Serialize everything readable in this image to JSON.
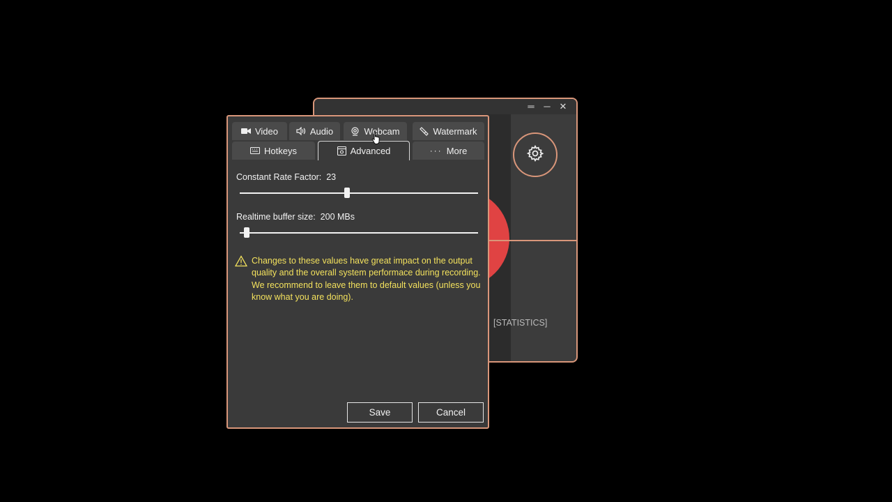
{
  "main_window": {
    "title_buttons": {
      "menu": "═",
      "minimize": "─",
      "close": "✕"
    },
    "statistics_label": "[STATISTICS]",
    "colors": {
      "accent": "#d9967a",
      "record": "#e04343"
    },
    "icons": {
      "settings": "gear-icon"
    }
  },
  "settings": {
    "tabs_row1": [
      {
        "label": "Video",
        "icon": "video-camera-icon"
      },
      {
        "label": "Audio",
        "icon": "speaker-icon"
      },
      {
        "label": "Webcam",
        "icon": "webcam-icon"
      },
      {
        "label": "Watermark",
        "icon": "watermark-icon"
      }
    ],
    "tabs_row2": [
      {
        "label": "Hotkeys",
        "icon": "keyboard-icon"
      },
      {
        "label": "Advanced",
        "icon": "advanced-icon",
        "active": true
      },
      {
        "label": "More",
        "icon": "more-icon"
      }
    ],
    "crf": {
      "label": "Constant Rate Factor:",
      "value": "23",
      "fraction": 0.45
    },
    "buffer": {
      "label": "Realtime buffer size:",
      "value": "200 MBs",
      "fraction": 0.03
    },
    "warning": {
      "icon": "warning-icon",
      "text": "Changes to these values have great impact on the output quality and the overall system performace during recording. We recommend to leave them to default values (unless you know what you are doing)."
    },
    "buttons": {
      "save": "Save",
      "cancel": "Cancel"
    },
    "colors": {
      "warning_text": "#f3e15d",
      "border": "#d9967a"
    }
  }
}
